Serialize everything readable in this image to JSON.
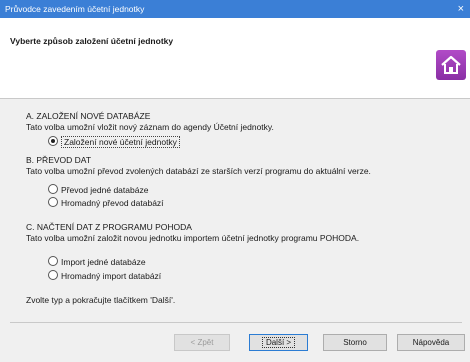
{
  "window": {
    "title": "Průvodce zavedením účetní jednotky",
    "close_glyph": "×"
  },
  "header": {
    "heading": "Vyberte způsob založení účetní jednotky",
    "logo_icon": "home-icon"
  },
  "sections": [
    {
      "title": "A. ZALOŽENÍ NOVÉ DATABÁZE",
      "description": "Tato volba umožní vložit nový záznam do agendy Účetní jednotky.",
      "options": [
        {
          "label": "Založení nové účetní jednotky",
          "selected": true
        }
      ]
    },
    {
      "title": "B. PŘEVOD DAT",
      "description": "Tato volba umožní převod zvolených databází ze starších verzí programu do aktuální verze.",
      "options": [
        {
          "label": "Převod jedné databáze",
          "selected": false
        },
        {
          "label": "Hromadný převod databází",
          "selected": false
        }
      ]
    },
    {
      "title": "C. NAČTENÍ DAT Z PROGRAMU POHODA",
      "description": "Tato volba umožní založit novou jednotku importem účetní jednotky programu POHODA.",
      "options": [
        {
          "label": "Import jedné databáze",
          "selected": false
        },
        {
          "label": "Hromadný import databází",
          "selected": false
        }
      ]
    }
  ],
  "footer_text": "Zvolte typ a pokračujte tlačítkem 'Další'.",
  "buttons": {
    "back": "< Zpět",
    "next": "Další >",
    "cancel": "Storno",
    "help": "Nápověda"
  },
  "colors": {
    "titlebar": "#3b7fd6",
    "logo": "#9b3bb8",
    "background": "#f0f0f0"
  }
}
